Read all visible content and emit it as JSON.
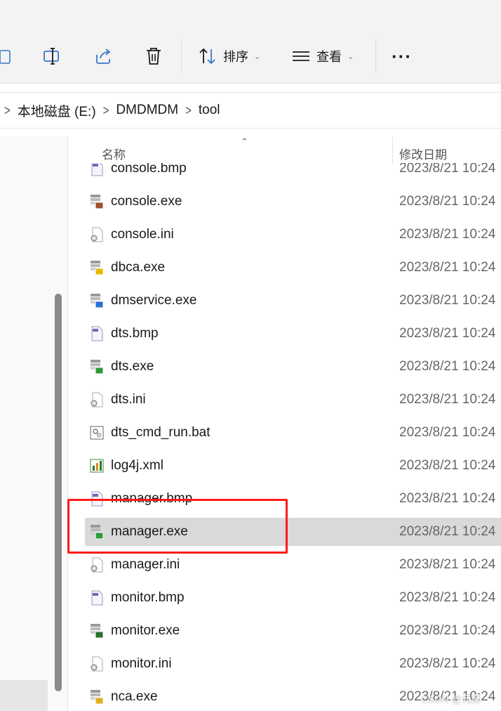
{
  "toolbar": {
    "sort_label": "排序",
    "view_label": "查看",
    "more_label": "···"
  },
  "breadcrumb": {
    "items": [
      "本地磁盘 (E:)",
      "DMDMDM",
      "tool"
    ]
  },
  "columns": {
    "name": "名称",
    "date": "修改日期"
  },
  "files": [
    {
      "name": "console.bmp",
      "date": "2023/8/21 10:24",
      "icon": "bitmap-icon"
    },
    {
      "name": "console.exe",
      "date": "2023/8/21 10:24",
      "icon": "application-icon"
    },
    {
      "name": "console.ini",
      "date": "2023/8/21 10:24",
      "icon": "settings-file-icon"
    },
    {
      "name": "dbca.exe",
      "date": "2023/8/21 10:24",
      "icon": "application-icon"
    },
    {
      "name": "dmservice.exe",
      "date": "2023/8/21 10:24",
      "icon": "application-icon"
    },
    {
      "name": "dts.bmp",
      "date": "2023/8/21 10:24",
      "icon": "bitmap-icon"
    },
    {
      "name": "dts.exe",
      "date": "2023/8/21 10:24",
      "icon": "application-icon"
    },
    {
      "name": "dts.ini",
      "date": "2023/8/21 10:24",
      "icon": "settings-file-icon"
    },
    {
      "name": "dts_cmd_run.bat",
      "date": "2023/8/21 10:24",
      "icon": "batch-file-icon"
    },
    {
      "name": "log4j.xml",
      "date": "2023/8/21 10:24",
      "icon": "xml-file-icon"
    },
    {
      "name": "manager.bmp",
      "date": "2023/8/21 10:24",
      "icon": "bitmap-icon"
    },
    {
      "name": "manager.exe",
      "date": "2023/8/21 10:24",
      "icon": "application-icon",
      "selected": true
    },
    {
      "name": "manager.ini",
      "date": "2023/8/21 10:24",
      "icon": "settings-file-icon"
    },
    {
      "name": "monitor.bmp",
      "date": "2023/8/21 10:24",
      "icon": "bitmap-icon"
    },
    {
      "name": "monitor.exe",
      "date": "2023/8/21 10:24",
      "icon": "application-icon"
    },
    {
      "name": "monitor.ini",
      "date": "2023/8/21 10:24",
      "icon": "settings-file-icon"
    },
    {
      "name": "nca.exe",
      "date": "2023/8/21 10:24",
      "icon": "application-icon"
    }
  ],
  "watermark": "CSDN @元彦",
  "colors": {
    "toolbar_bg": "#f3f3f3",
    "selected_row": "#d9d9d9",
    "highlight_border": "#ff1a1a"
  }
}
